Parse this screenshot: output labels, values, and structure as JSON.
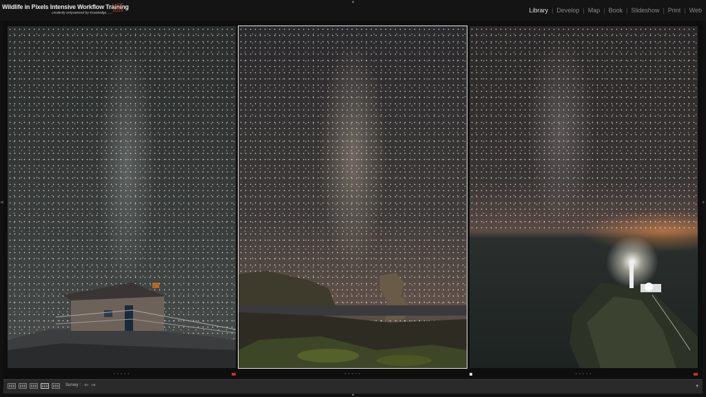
{
  "header": {
    "title": "Wildlife in Pixels Intensive Workflow Training",
    "subtitle": "creativity empowered by knowledge.......",
    "logo_line1": "LrCC",
    "logo_line2": "2019"
  },
  "modules": [
    {
      "label": "Library",
      "active": true
    },
    {
      "label": "Develop",
      "active": false
    },
    {
      "label": "Map",
      "active": false
    },
    {
      "label": "Book",
      "active": false
    },
    {
      "label": "Slideshow",
      "active": false
    },
    {
      "label": "Print",
      "active": false
    },
    {
      "label": "Web",
      "active": false
    }
  ],
  "module_separator": "|",
  "survey": {
    "photos": [
      {
        "subject": "milky-way-hut",
        "rating_dots": "• • • • •",
        "selected": false,
        "flag": "red"
      },
      {
        "subject": "milky-way-sea-stack",
        "rating_dots": "• • • • •",
        "selected": true,
        "flag": "none"
      },
      {
        "subject": "milky-way-lighthouse",
        "rating_dots": "• • • • •",
        "selected": false,
        "flag": "red"
      }
    ]
  },
  "toolbar": {
    "view_label": "Survey :",
    "prev_glyph": "⇐",
    "next_glyph": "⇒",
    "chevron_glyph": "▾"
  },
  "icons": {
    "top_panel_arrow": "▲",
    "bottom_panel_arrow": "▲",
    "left_panel_arrow": "◀",
    "right_panel_arrow": "▶"
  },
  "colors": {
    "accent_logo": "#d9502e",
    "active_module": "#e0e0e0",
    "inactive_module": "#8a8a8a"
  }
}
